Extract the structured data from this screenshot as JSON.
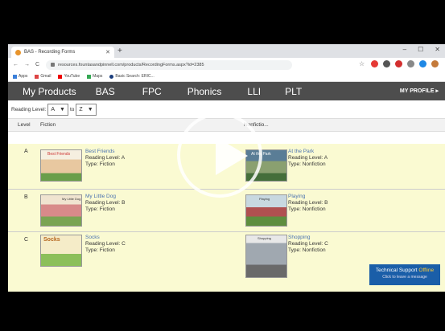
{
  "browser": {
    "tab_title": "BAS - Recording Forms",
    "url": "resources.fountasandpinnell.com/products/RecordingForms.aspx?id=2385",
    "bookmarks": [
      "Apps",
      "Gmail",
      "YouTube",
      "Maps",
      "Basic Search: ERIC..."
    ]
  },
  "site_nav": {
    "items": [
      "My Products",
      "BAS",
      "FPC",
      "Phonics",
      "LLI",
      "PLT"
    ],
    "profile": "MY PROFILE ▸"
  },
  "filter": {
    "label": "Reading Level:",
    "from": "A",
    "to_label": "to",
    "to": "Z"
  },
  "table": {
    "headers": {
      "level": "Level",
      "fiction": "Fiction",
      "nonfiction": "Nonfictio..."
    },
    "rows": [
      {
        "level": "A",
        "fiction": {
          "title": "Best Friends",
          "level": "Reading Level: A",
          "type": "Type: Fiction",
          "cover_text": "Best Friends"
        },
        "nonfiction": {
          "title": "At the Park",
          "level": "Reading Level: A",
          "type": "Type: Nonfiction",
          "cover_text": "At the Park"
        }
      },
      {
        "level": "B",
        "fiction": {
          "title": "My Little Dog",
          "level": "Reading Level: B",
          "type": "Type: Fiction",
          "cover_text": "My Little Dog"
        },
        "nonfiction": {
          "title": "Playing",
          "level": "Reading Level: B",
          "type": "Type: Nonfiction",
          "cover_text": "Playing"
        }
      },
      {
        "level": "C",
        "fiction": {
          "title": "Socks",
          "level": "Reading Level: C",
          "type": "Type: Fiction",
          "cover_text": "Socks"
        },
        "nonfiction": {
          "title": "Shopping",
          "level": "Reading Level: C",
          "type": "Type: Nonfiction",
          "cover_text": "Shopping"
        }
      }
    ]
  },
  "support": {
    "line1": "Technical Support",
    "status": "Offline",
    "line2": "Click to leave a message"
  },
  "colors": {
    "nav_bg": "#4d4d4d",
    "row_bg": "#fafad2",
    "link": "#4a72b0",
    "support_bg": "#1a5ea8"
  }
}
